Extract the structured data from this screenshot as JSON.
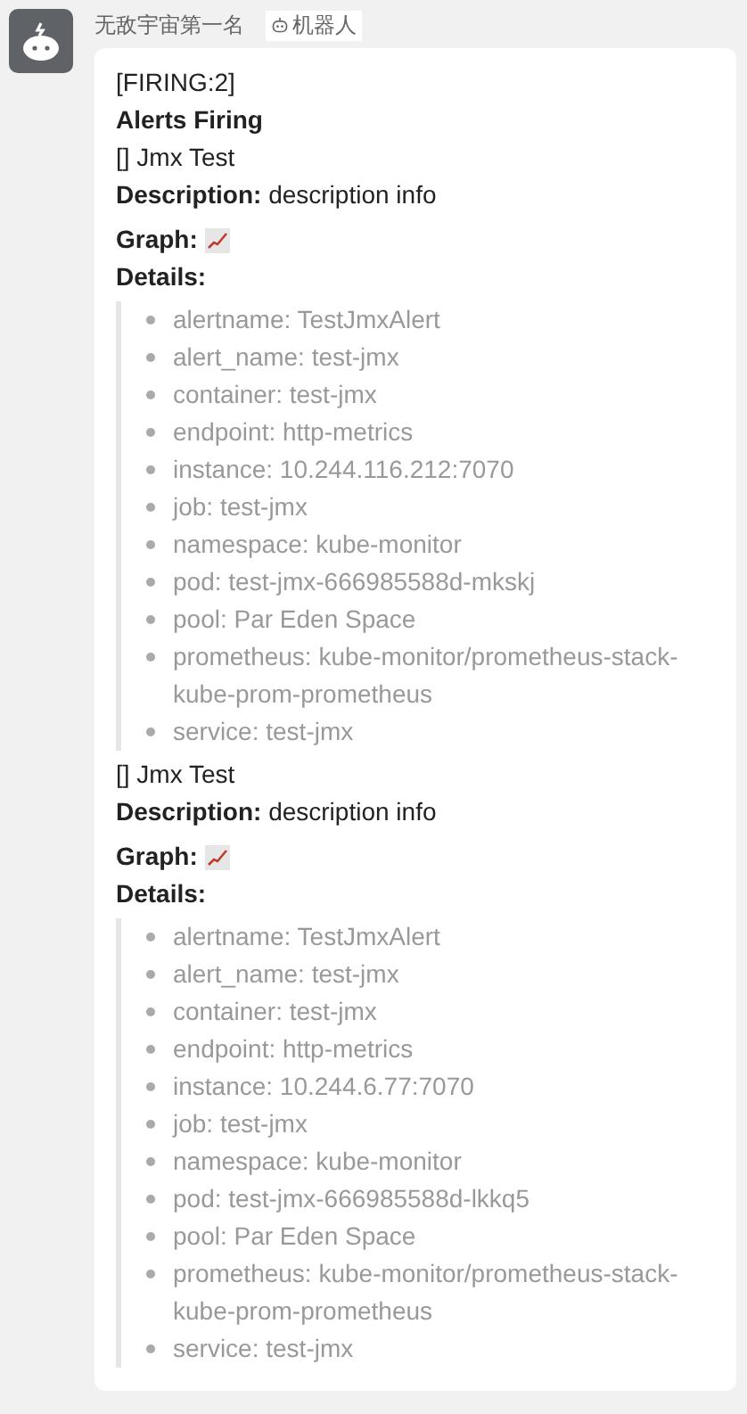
{
  "sender": {
    "name": "无敌宇宙第一名",
    "tag": "机器人"
  },
  "message": {
    "status": "[FIRING:2]",
    "heading": "Alerts Firing",
    "alerts": [
      {
        "title": "[] Jmx Test",
        "description": "**Description:** description info",
        "graph_label": "Graph:",
        "details_label": "Details:",
        "details": [
          "alertname: TestJmxAlert",
          "alert_name: test-jmx",
          "container: test-jmx",
          "endpoint: http-metrics",
          "instance: 10.244.116.212:7070",
          "job: test-jmx",
          "namespace: kube-monitor",
          "pod: test-jmx-666985588d-mkskj",
          "pool: Par Eden Space",
          "prometheus: kube-monitor/prometheus-stack-kube-prom-prometheus",
          "service: test-jmx"
        ]
      },
      {
        "title": "[] Jmx Test",
        "description": "**Description:** description info",
        "graph_label": "Graph:",
        "details_label": "Details:",
        "details": [
          "alertname: TestJmxAlert",
          "alert_name: test-jmx",
          "container: test-jmx",
          "endpoint: http-metrics",
          "instance: 10.244.6.77:7070",
          "job: test-jmx",
          "namespace: kube-monitor",
          "pod: test-jmx-666985588d-lkkq5",
          "pool: Par Eden Space",
          "prometheus: kube-monitor/prometheus-stack-kube-prom-prometheus",
          "service: test-jmx"
        ]
      }
    ]
  }
}
